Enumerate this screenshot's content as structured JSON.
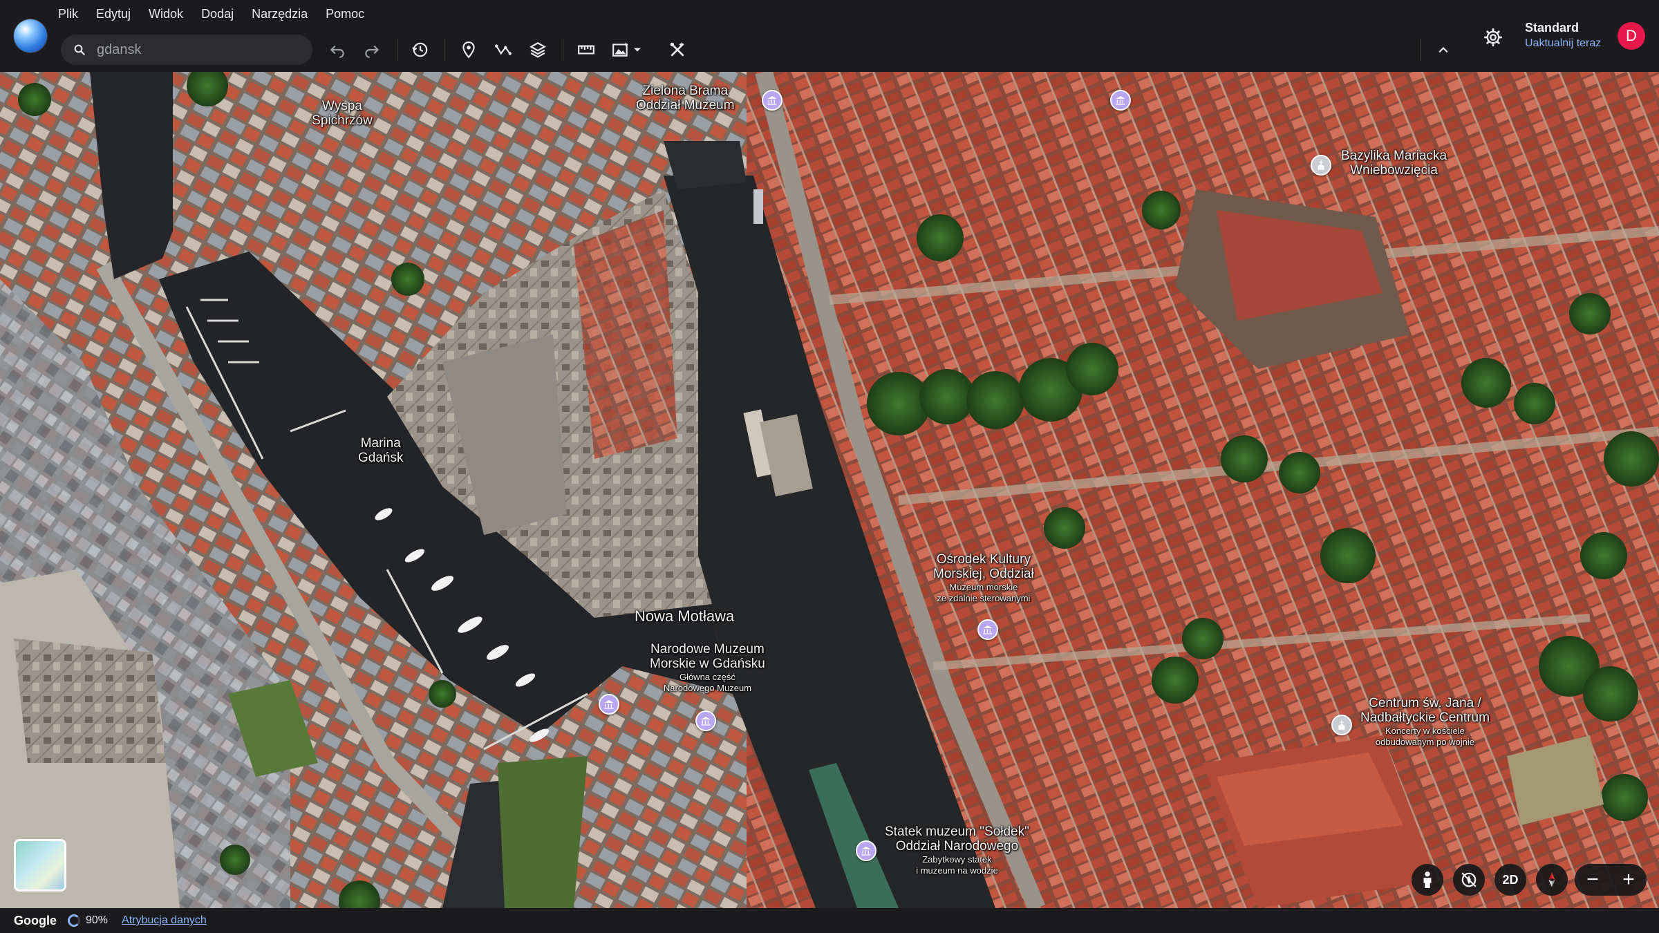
{
  "menu": [
    "Plik",
    "Edytuj",
    "Widok",
    "Dodaj",
    "Narzędzia",
    "Pomoc"
  ],
  "search": {
    "value": "gdansk"
  },
  "toolbar_icons": [
    "undo-icon",
    "redo-icon",
    "history-icon",
    "placemark-icon",
    "path-icon",
    "layers-icon",
    "ruler-icon",
    "photo-icon",
    "dropdown-icon",
    "measure-tool-icon"
  ],
  "profile": {
    "name": "Standard",
    "subtitle": "Uaktualnij teraz",
    "avatar_letter": "D"
  },
  "map_labels": {
    "wyspa": "Wyspa Spichrzów",
    "zielona_brama_1": "Zielona Brama",
    "zielona_brama_2": "Oddział Muzeum",
    "bazylika_1": "Bazylika Mariacka",
    "bazylika_2": "Wniebowzięcia",
    "marina_1": "Marina",
    "marina_2": "Gdańsk",
    "osrodek_1": "Ośrodek Kultury",
    "osrodek_2": "Morskiej, Oddział",
    "osrodek_3": "Muzeum morskie",
    "osrodek_4": "ze zdalnie sterowanymi",
    "nowa_motlawa": "Nowa Motława",
    "narodowe_1": "Narodowe Muzeum",
    "narodowe_2": "Morskie w Gdańsku",
    "narodowe_3": "Główna część",
    "narodowe_4": "Narodowego Muzeum",
    "centrum_1": "Centrum św. Jana /",
    "centrum_2": "Nadbałtyckie Centrum",
    "centrum_3": "Koncerty w kościele",
    "centrum_4": "odbudowanym po wojnie",
    "soldek_1": "Statek muzeum \"Sołdek\"",
    "soldek_2": "Oddział Narodowego",
    "soldek_3": "Zabytkowy statek",
    "soldek_4": "i muzeum na wodzie"
  },
  "controls": {
    "view_mode": "2D",
    "zoom_out": "−",
    "zoom_in": "+"
  },
  "status": {
    "brand": "Google",
    "progress_percent": 90,
    "progress_label": "90%",
    "attribution": "Atrybucja danych"
  },
  "colors": {
    "water": "#252628",
    "roof": "#b5483a",
    "tree": "#2f5a23",
    "accent": "#8ab4f8",
    "avatar": "#e8174a"
  }
}
